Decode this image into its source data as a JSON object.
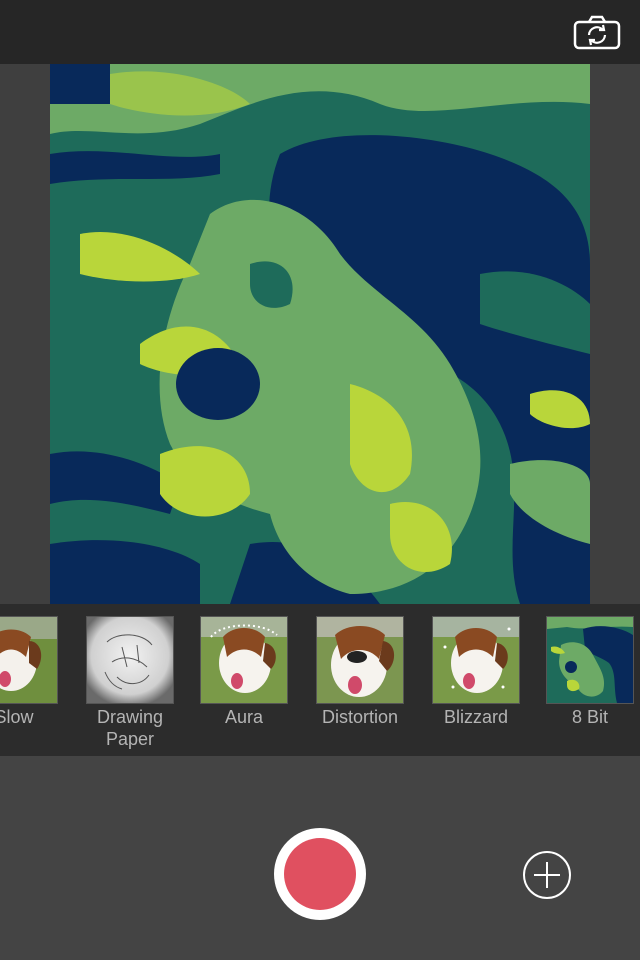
{
  "toolbar": {
    "flip_camera_icon": "camera-flip-icon"
  },
  "filters": [
    {
      "label": "Slow"
    },
    {
      "label_line1": "Drawing",
      "label_line2": "Paper"
    },
    {
      "label": "Aura"
    },
    {
      "label": "Distortion"
    },
    {
      "label": "Blizzard"
    },
    {
      "label": "8 Bit"
    }
  ],
  "controls": {
    "record_icon": "record-icon",
    "add_icon": "plus-circle-icon"
  },
  "colors": {
    "record_red": "#e05060",
    "palette_8bit": [
      "#08295a",
      "#1e6b5a",
      "#6daa66",
      "#b9d63a"
    ]
  }
}
